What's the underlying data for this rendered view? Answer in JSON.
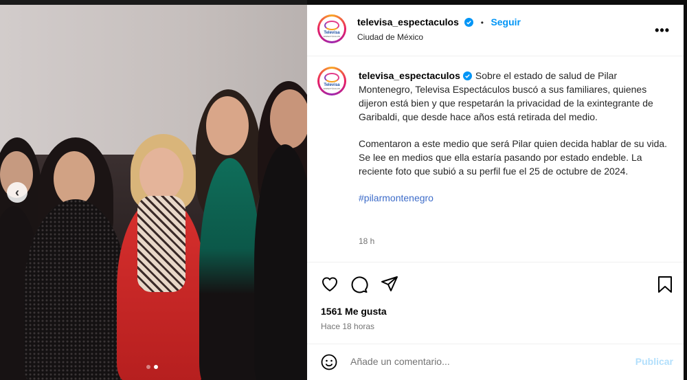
{
  "post": {
    "username": "televisa_espectaculos",
    "follow_label": "Seguir",
    "separator": "•",
    "location": "Ciudad de México",
    "more_label": "•••",
    "logo_text": "Televisa",
    "logo_sub": "ESPECTÁCULOS",
    "caption_username": "televisa_espectaculos",
    "caption_p1": "Sobre el estado de salud de Pilar Montenegro, Televisa Espectáculos buscó a sus familiares, quienes dijeron está bien y que respetarán la privacidad de la exintegrante de Garibaldi, que desde hace años está retirada del medio.",
    "caption_p2": "Comentaron a este medio que será Pilar quien decida hablar de su vida. Se lee en medios que ella estaría pasando por estado endeble. La reciente foto que subió a su perfil fue el 25 de octubre de 2024.",
    "hashtag": "#pilarmontenegro",
    "time": "18 h",
    "likes": "1561 Me gusta",
    "ago": "Hace 18 horas",
    "comment_placeholder": "Añade un comentario...",
    "publish_label": "Publicar"
  },
  "carousel": {
    "prev_label": "‹",
    "total_slides": 2,
    "active_slide": 2
  },
  "colors": {
    "link": "#0095f6",
    "hashtag": "#3d6cc9",
    "publish_disabled": "#b2dffc"
  }
}
